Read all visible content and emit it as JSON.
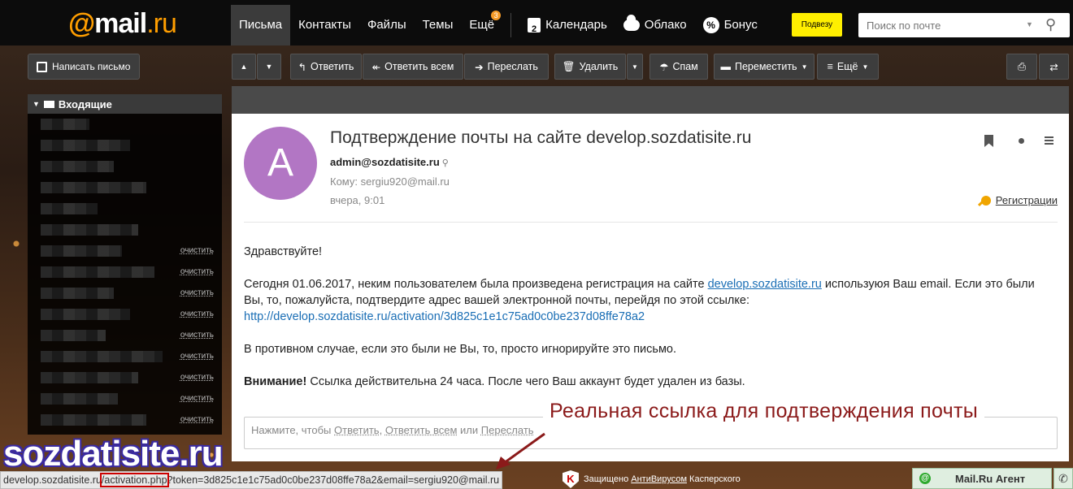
{
  "header": {
    "logo": {
      "at": "@",
      "mail": "mail",
      "ru": ".ru"
    },
    "nav": [
      {
        "label": "Письма",
        "active": true
      },
      {
        "label": "Контакты"
      },
      {
        "label": "Файлы"
      },
      {
        "label": "Темы"
      },
      {
        "label": "Ещё",
        "badge": "3"
      }
    ],
    "services": [
      {
        "label": "Календарь",
        "icon": "calendar-icon",
        "icon_text": "2"
      },
      {
        "label": "Облако",
        "icon": "cloud-icon"
      },
      {
        "label": "Бонус",
        "icon": "bonus-icon",
        "icon_text": "%"
      }
    ],
    "promo_button": "Подвезу",
    "search_placeholder": "Поиск по почте"
  },
  "sidebar": {
    "compose_label": "Написать письмо",
    "folder_title": "Входящие",
    "clear_label": "очистить",
    "rows": [
      {
        "clear": false
      },
      {
        "clear": false
      },
      {
        "clear": false
      },
      {
        "clear": false
      },
      {
        "clear": false
      },
      {
        "clear": false
      },
      {
        "clear": true
      },
      {
        "clear": true
      },
      {
        "clear": true
      },
      {
        "clear": true
      },
      {
        "clear": true
      },
      {
        "clear": true
      },
      {
        "clear": true
      },
      {
        "clear": true
      },
      {
        "clear": true
      }
    ]
  },
  "toolbar": {
    "up": "▲",
    "down": "▼",
    "reply": "Ответить",
    "reply_all": "Ответить всем",
    "forward": "Переслать",
    "delete": "Удалить",
    "spam": "Спам",
    "move": "Переместить",
    "more": "Ещё"
  },
  "message": {
    "avatar_letter": "A",
    "subject": "Подтверждение почты на сайте develop.sozdatisite.ru",
    "from": "admin@sozdatisite.ru",
    "to": "Кому: sergiu920@mail.ru",
    "date": "вчера, 9:01",
    "category": "Регистрации",
    "greeting": "Здравствуйте!",
    "para1_before": "Сегодня 01.06.2017, неким пользователем была произведена регистрация на сайте ",
    "para1_link": "develop.sozdatisite.ru",
    "para1_after": " используюя Ваш email. Если это были Вы, то, пожалуйста, подтвердите адрес вашей электронной почты, перейдя по этой ссылке:",
    "activation_link": "http://develop.sozdatisite.ru/activation/3d825c1e1c75ad0c0be237d08ffe78a2",
    "para2": "В противном случае, если это были не Вы, то, просто игнорируйте это письмо.",
    "warning_bold": "Внимание!",
    "warning_text": " Ссылка действительна 24 часа. После чего Ваш аккаунт будет удален из базы."
  },
  "quick_reply": {
    "prefix": "Нажмите, чтобы ",
    "reply": "Ответить",
    "sep1": ", ",
    "reply_all": "Ответить всем",
    "sep2": " или ",
    "forward": "Переслать"
  },
  "annotation": {
    "caption": "Реальная ссылка для подтверждения почты"
  },
  "watermark": "sozdatisite.ru",
  "statusbar": {
    "url_part1": "develop.sozdatisite.ru",
    "url_highlight": "/activation.php",
    "url_part2": "?token=3d825c1e1c75ad0c0be237d08ffe78a2&email=sergiu920@mail.ru",
    "kasper_prefix": "Защищено ",
    "kasper_link": "АнтиВирусом",
    "kasper_suffix": " Касперского",
    "agent_label": "Mail.Ru Агент"
  }
}
